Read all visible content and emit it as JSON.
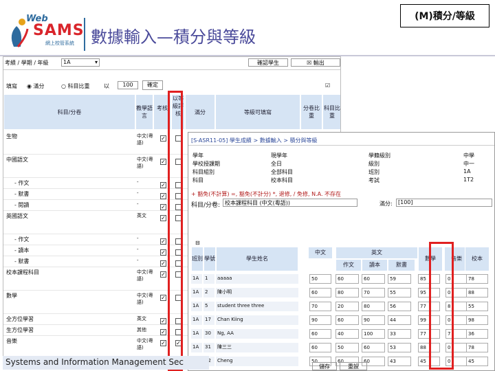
{
  "logo": {
    "web": "Web",
    "sams": "SAMS",
    "sub": "網上校管系統"
  },
  "page_title": "數據輸入—積分與等級",
  "corner_label": "(M)積分/等級",
  "footer": "Systems and Information Management Sec",
  "left": {
    "toolbar": {
      "label": "考績 / 學期 / 年級",
      "value": "1A",
      "button1": "確認學生",
      "button2": "輸出"
    },
    "option_row": {
      "label": "填寫",
      "radio1": "滿分",
      "radio2": "科目比重",
      "pct_label": "以",
      "pct_value": "100",
      "confirm": "確定"
    },
    "headers": {
      "subject": "科目/分卷",
      "lang": "教學語言",
      "exam": "考核",
      "grade": "以等級評核",
      "score": "滿分",
      "level": "等級可填寫",
      "fullmark": "分卷比重",
      "weight": "科目比重"
    },
    "rows": [
      {
        "name": "生物",
        "lang": "中文(粵語)",
        "exam": true,
        "grade": false
      },
      {
        "name": "中國語文",
        "lang": "中文(粵語)",
        "exam": true,
        "grade": false
      },
      {
        "name": "- 作文",
        "lang": "-",
        "exam": true,
        "grade": false
      },
      {
        "name": "- 默書",
        "lang": "-",
        "exam": true,
        "grade": false
      },
      {
        "name": "- 閱讀",
        "lang": "-",
        "exam": true,
        "grade": false
      },
      {
        "name": "英國語文",
        "lang": "英文",
        "exam": true,
        "grade": false
      },
      {
        "name": "- 作文",
        "lang": "-",
        "exam": true,
        "grade": false
      },
      {
        "name": "- 讀本",
        "lang": "-",
        "exam": true,
        "grade": false
      },
      {
        "name": "- 默書",
        "lang": "-",
        "exam": true,
        "grade": false
      },
      {
        "name": "校本課程科目",
        "lang": "中文(粵語)",
        "exam": true,
        "grade": false
      },
      {
        "name": "數學",
        "lang": "中文(粵語)",
        "exam": true,
        "grade": false
      },
      {
        "name": "全方位學習",
        "lang": "英文",
        "exam": true,
        "grade": false
      },
      {
        "name": "生方位學習",
        "lang": "其他",
        "exam": true,
        "grade": false
      },
      {
        "name": "音樂",
        "lang": "中文(粵語)",
        "exam": true,
        "grade": true
      }
    ]
  },
  "right": {
    "breadcrumb": "[S-ASR11-05] 學生成績 > 數據輸入 > 積分與等級",
    "info_left": [
      [
        "學年",
        "現學年"
      ],
      [
        "學校授課期",
        "全日"
      ],
      [
        "科目組別",
        "全部科目"
      ],
      [
        "科目",
        "校本科目"
      ]
    ],
    "info_left_vals": [
      "2016",
      "全日",
      "全部科目",
      "校本科目"
    ],
    "info_right": [
      [
        "學籍級別",
        "中學"
      ],
      [
        "級別",
        "中一"
      ],
      [
        "班別",
        "1A"
      ],
      [
        "考試",
        "1T2"
      ]
    ],
    "legend": "+ 豁免(不計算) =, 豁免(不計分) *, 退修, / 免修, N.A. 不存在",
    "subject_label": "科目/分卷:",
    "subject_value": "校本課程科目 (中文(粵語))",
    "score_label": "滿分:",
    "score_value": "[100]",
    "col_headers": {
      "class": "班別",
      "classno": "學號",
      "name": "學生姓名",
      "chinese": "中文",
      "english": "英文",
      "essay": "作文",
      "reader": "讀本",
      "dictation": "默書",
      "math": "數學",
      "music": "音樂",
      "school": "校本"
    },
    "students": [
      {
        "class": "1A",
        "no": "1",
        "name": "aaaaa",
        "c": "50",
        "e1": "60",
        "e2": "60",
        "e3": "59",
        "m": "85",
        "mu": "0",
        "s": "78"
      },
      {
        "class": "1A",
        "no": "2",
        "name": "陳小明",
        "c": "60",
        "e1": "80",
        "e2": "70",
        "e3": "55",
        "m": "95",
        "mu": "0",
        "s": "88"
      },
      {
        "class": "1A",
        "no": "5",
        "name": "student three three",
        "c": "70",
        "e1": "20",
        "e2": "80",
        "e3": "56",
        "m": "77",
        "mu": "8",
        "s": "55"
      },
      {
        "class": "1A",
        "no": "17",
        "name": "Chan Kiing",
        "c": "90",
        "e1": "60",
        "e2": "90",
        "e3": "44",
        "m": "99",
        "mu": "0",
        "s": "98"
      },
      {
        "class": "1A",
        "no": "30",
        "name": "Ng, AA",
        "c": "60",
        "e1": "40",
        "e2": "100",
        "e3": "33",
        "m": "77",
        "mu": "7",
        "s": "36"
      },
      {
        "class": "1A",
        "no": "31",
        "name": "陳三三",
        "c": "60",
        "e1": "50",
        "e2": "60",
        "e3": "53",
        "m": "88",
        "mu": "0",
        "s": "78"
      },
      {
        "class": "1A",
        "no": "32",
        "name": "Cheng",
        "c": "50",
        "e1": "60",
        "e2": "60",
        "e3": "43",
        "m": "45",
        "mu": "0",
        "s": "45"
      }
    ],
    "save": "儲存",
    "reset": "重設"
  }
}
